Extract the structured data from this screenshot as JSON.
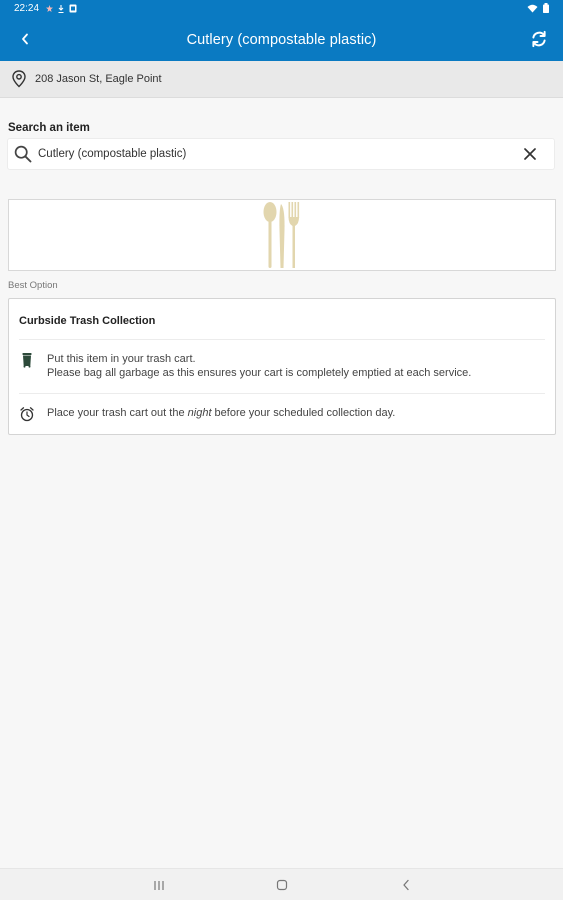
{
  "status_bar": {
    "time": "22:24"
  },
  "app_bar": {
    "title": "Cutlery (compostable plastic)"
  },
  "address": {
    "text": "208 Jason St, Eagle Point"
  },
  "search": {
    "label": "Search an item",
    "value": "Cutlery (compostable plastic)"
  },
  "best_option": {
    "label": "Best Option",
    "card_title": "Curbside Trash Collection",
    "instruction_line1": "Put this item in your trash cart.",
    "instruction_line2": "Please bag all garbage as this ensures your cart is completely emptied at each service.",
    "schedule_prefix": "Place your trash cart out the ",
    "schedule_emphasis": "night",
    "schedule_suffix": " before your scheduled collection day."
  },
  "icons": {
    "back": "chevron-left-icon",
    "refresh": "refresh-icon",
    "location": "location-pin-icon",
    "search": "search-icon",
    "clear": "close-icon",
    "trash_cart": "trash-cart-icon",
    "clock": "alarm-clock-icon",
    "cutlery": "cutlery-image"
  },
  "colors": {
    "header_blue": "#0a7ac2",
    "address_bar_gray": "#e9e9e9",
    "background": "#f7f7f7",
    "cutlery_beige": "#e2d6ae",
    "trash_cart": "#2d4a3a"
  }
}
